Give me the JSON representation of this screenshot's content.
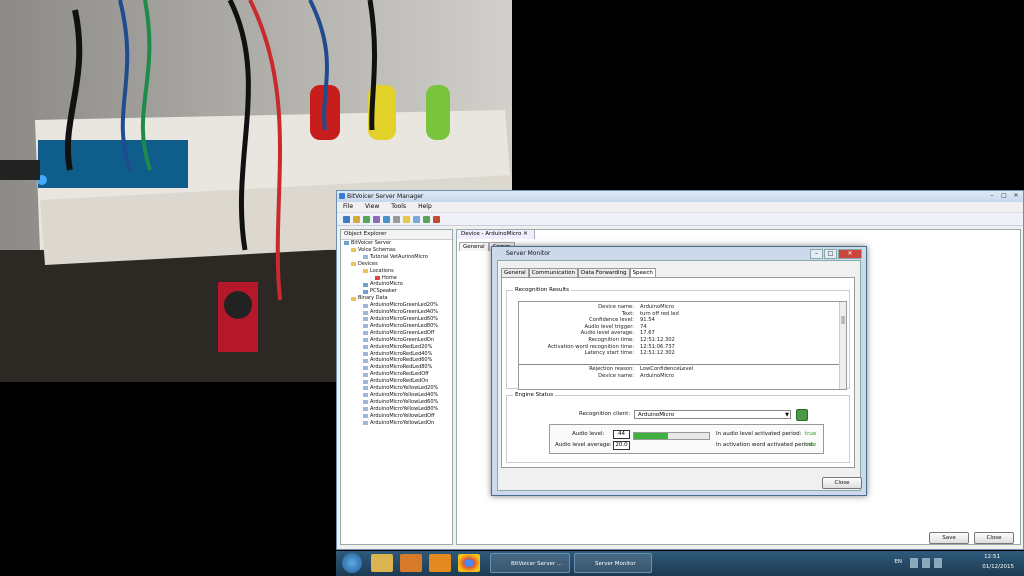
{
  "app": {
    "title": "BitVoicer Server Manager",
    "menu": [
      "File",
      "View",
      "Tools",
      "Help"
    ],
    "explorer_title": "Object Explorer",
    "tree": {
      "root": "BitVoicer Server",
      "voice_schemas": "Voice Schemas",
      "tutorial_schema": "Tutorial VetAurinoMicro",
      "devices": "Devices",
      "locations": "Locations",
      "home": "Home",
      "device1": "ArduinoMicro",
      "device2": "PCSpeaker",
      "binary_data": "Binary Data",
      "binary_items": [
        "ArduinoMicroGreenLed20%",
        "ArduinoMicroGreenLed40%",
        "ArduinoMicroGreenLed60%",
        "ArduinoMicroGreenLed80%",
        "ArduinoMicroGreenLedOff",
        "ArduinoMicroGreenLedOn",
        "ArduinoMicroRedLed20%",
        "ArduinoMicroRedLed40%",
        "ArduinoMicroRedLed60%",
        "ArduinoMicroRedLed80%",
        "ArduinoMicroRedLedOff",
        "ArduinoMicroRedLedOn",
        "ArduinoMicroYellowLed20%",
        "ArduinoMicroYellowLed40%",
        "ArduinoMicroYellowLed60%",
        "ArduinoMicroYellowLed80%",
        "ArduinoMicroYellowLedOff",
        "ArduinoMicroYellowLedOn"
      ]
    },
    "doc_tab": "Device - ArduinoMicro",
    "doc_subtabs": [
      "General",
      "Comm"
    ],
    "save_label": "Save",
    "close_label": "Close"
  },
  "dialog": {
    "title": "Server Monitor",
    "tabs": [
      "General",
      "Communication",
      "Data Forwarding",
      "Speech"
    ],
    "recognition_title": "Recognition Results",
    "results": [
      {
        "k": "Device name:",
        "v": "ArduinoMicro"
      },
      {
        "k": "Text:",
        "v": "turn off red led"
      },
      {
        "k": "Confidence level:",
        "v": "91.54"
      },
      {
        "k": "Audio level trigger:",
        "v": "74"
      },
      {
        "k": "Audio level average:",
        "v": "17.67"
      },
      {
        "k": "Recognition time:",
        "v": "12:51:12.302"
      },
      {
        "k": "Activation word recognition time:",
        "v": "12:51:06.737"
      },
      {
        "k": "Latency start time:",
        "v": "12:51:12.302"
      }
    ],
    "rejection": [
      {
        "k": "Rejection reason:",
        "v": "LowConfidenceLevel"
      },
      {
        "k": "Device name:",
        "v": "ArduinoMicro"
      }
    ],
    "engine_title": "Engine Status",
    "recognition_client_label": "Recognition client:",
    "recognition_client_value": "ArduinoMicro",
    "audio_level_label": "Audio level:",
    "audio_level_value": "44",
    "audio_level_fraction": 0.45,
    "audio_avg_label": "Audio level average:",
    "audio_avg_value": "20.0",
    "activated_label": "In audio level activated period:",
    "activated_value": "true",
    "activation_word_label": "In activation word activated period:",
    "activation_word_value": "true",
    "close_label": "Close"
  },
  "taskbar": {
    "task1": "BitVoicer Server ...",
    "task2": "Server Monitor",
    "lang": "EN",
    "time": "12:51",
    "date": "01/12/2015"
  }
}
